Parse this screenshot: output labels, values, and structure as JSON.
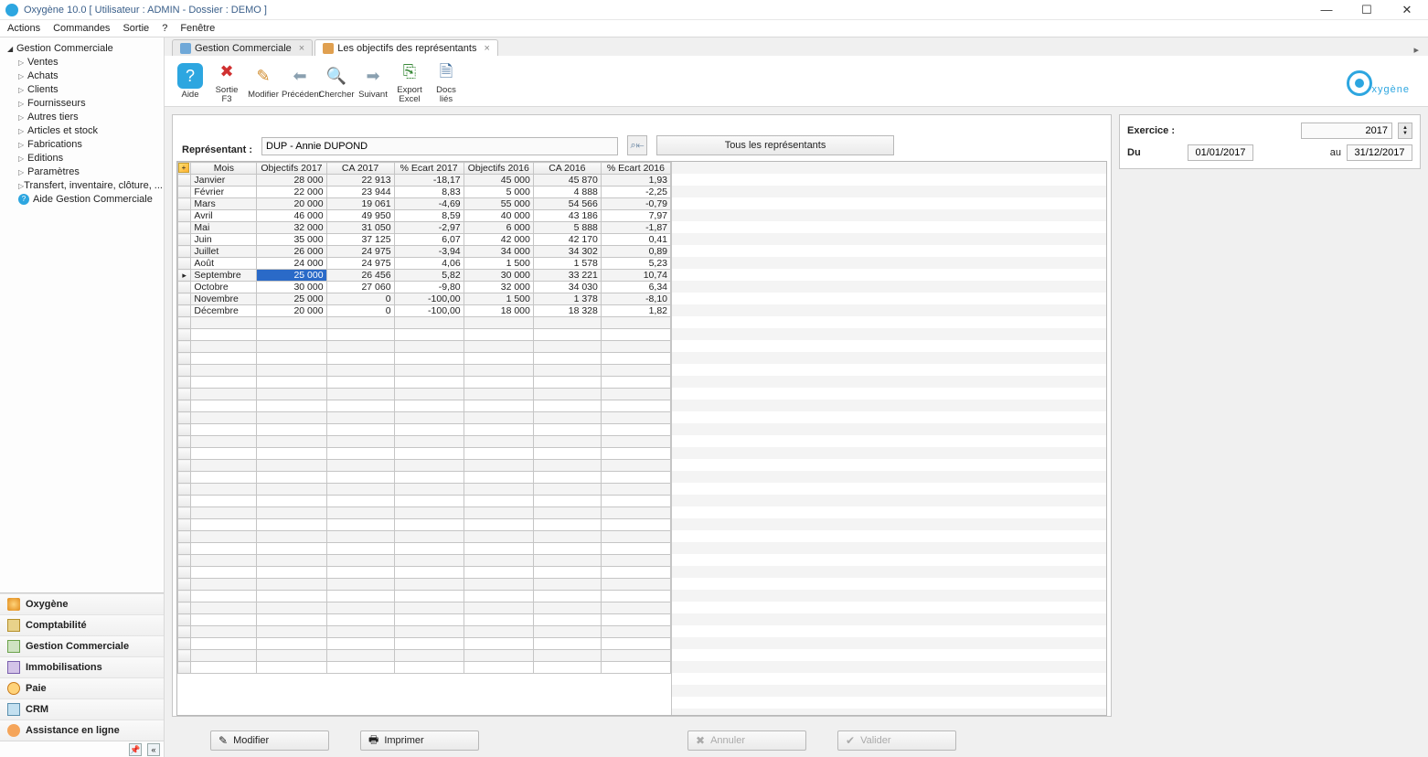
{
  "window": {
    "title": "Oxygène 10.0 [ Utilisateur : ADMIN - Dossier : DEMO ]"
  },
  "menu": [
    "Actions",
    "Commandes",
    "Sortie",
    "?",
    "Fenêtre"
  ],
  "tree": {
    "root": "Gestion Commerciale",
    "items": [
      "Ventes",
      "Achats",
      "Clients",
      "Fournisseurs",
      "Autres tiers",
      "Articles et stock",
      "Fabrications",
      "Editions",
      "Paramètres",
      "Transfert, inventaire, clôture, ..."
    ],
    "help": "Aide Gestion Commerciale"
  },
  "navgroups": [
    "Oxygène",
    "Comptabilité",
    "Gestion Commerciale",
    "Immobilisations",
    "Paie",
    "CRM",
    "Assistance en ligne"
  ],
  "tabs": {
    "t1": "Gestion Commerciale",
    "t2": "Les objectifs des représentants"
  },
  "toolbar": {
    "aide": "Aide",
    "sortie": "Sortie\nF3",
    "modifier": "Modifier",
    "precedent": "Précédent",
    "chercher": "Chercher",
    "suivant": "Suivant",
    "export": "Export\nExcel",
    "docs": "Docs\nliés"
  },
  "logo": "xygène",
  "filter": {
    "label": "Représentant :",
    "value": "DUP - Annie DUPOND",
    "all": "Tous les représentants"
  },
  "period": {
    "ex_label": "Exercice :",
    "year": "2017",
    "du": "Du",
    "from": "01/01/2017",
    "au": "au",
    "to": "31/12/2017"
  },
  "grid": {
    "headers": [
      "Mois",
      "Objectifs 2017",
      "CA 2017",
      "% Ecart 2017",
      "Objectifs 2016",
      "CA 2016",
      "% Ecart 2016"
    ],
    "rows": [
      {
        "m": "Janvier",
        "o17": "28 000",
        "ca17": "22 913",
        "e17": "-18,17",
        "o16": "45 000",
        "ca16": "45 870",
        "e16": "1,93"
      },
      {
        "m": "Février",
        "o17": "22 000",
        "ca17": "23 944",
        "e17": "8,83",
        "o16": "5 000",
        "ca16": "4 888",
        "e16": "-2,25"
      },
      {
        "m": "Mars",
        "o17": "20 000",
        "ca17": "19 061",
        "e17": "-4,69",
        "o16": "55 000",
        "ca16": "54 566",
        "e16": "-0,79"
      },
      {
        "m": "Avril",
        "o17": "46 000",
        "ca17": "49 950",
        "e17": "8,59",
        "o16": "40 000",
        "ca16": "43 186",
        "e16": "7,97"
      },
      {
        "m": "Mai",
        "o17": "32 000",
        "ca17": "31 050",
        "e17": "-2,97",
        "o16": "6 000",
        "ca16": "5 888",
        "e16": "-1,87"
      },
      {
        "m": "Juin",
        "o17": "35 000",
        "ca17": "37 125",
        "e17": "6,07",
        "o16": "42 000",
        "ca16": "42 170",
        "e16": "0,41"
      },
      {
        "m": "Juillet",
        "o17": "26 000",
        "ca17": "24 975",
        "e17": "-3,94",
        "o16": "34 000",
        "ca16": "34 302",
        "e16": "0,89"
      },
      {
        "m": "Août",
        "o17": "24 000",
        "ca17": "24 975",
        "e17": "4,06",
        "o16": "1 500",
        "ca16": "1 578",
        "e16": "5,23"
      },
      {
        "m": "Septembre",
        "o17": "25 000",
        "ca17": "26 456",
        "e17": "5,82",
        "o16": "30 000",
        "ca16": "33 221",
        "e16": "10,74",
        "sel": true,
        "cur": true
      },
      {
        "m": "Octobre",
        "o17": "30 000",
        "ca17": "27 060",
        "e17": "-9,80",
        "o16": "32 000",
        "ca16": "34 030",
        "e16": "6,34"
      },
      {
        "m": "Novembre",
        "o17": "25 000",
        "ca17": "0",
        "e17": "-100,00",
        "o16": "1 500",
        "ca16": "1 378",
        "e16": "-8,10"
      },
      {
        "m": "Décembre",
        "o17": "20 000",
        "ca17": "0",
        "e17": "-100,00",
        "o16": "18 000",
        "ca16": "18 328",
        "e16": "1,82"
      }
    ],
    "empty_rows": 30
  },
  "footer": {
    "modifier": "Modifier",
    "imprimer": "Imprimer",
    "annuler": "Annuler",
    "valider": "Valider"
  }
}
